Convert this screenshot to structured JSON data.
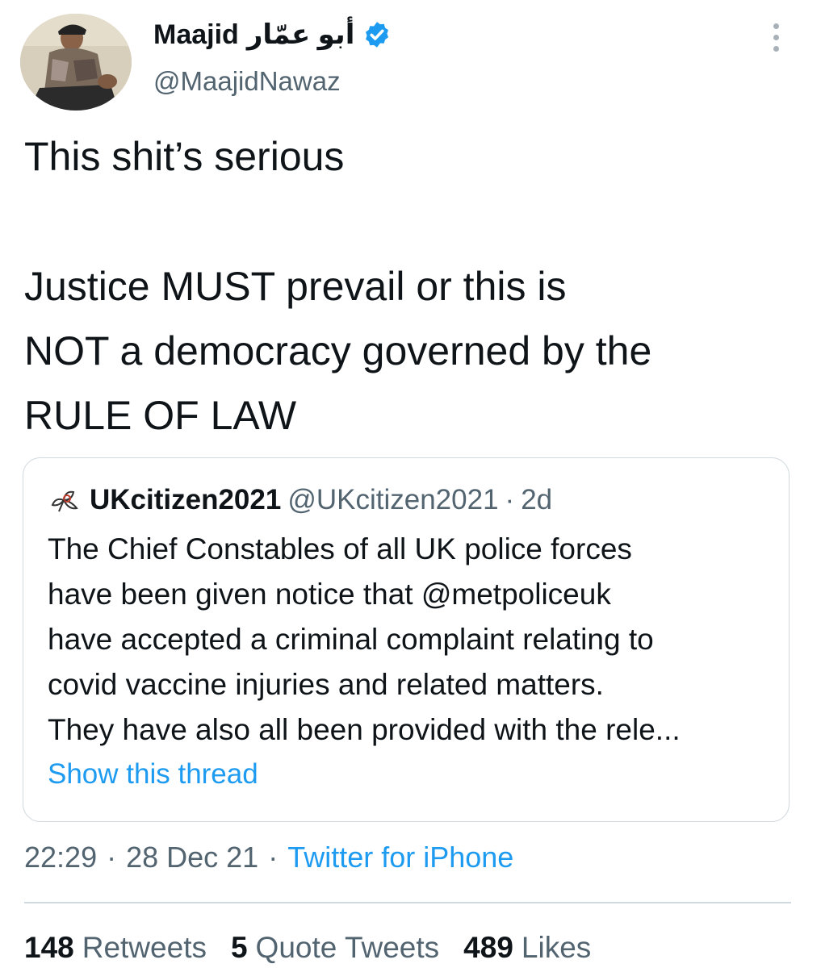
{
  "author": {
    "name": "Maajid",
    "arabic_name": "أبو عمّار",
    "handle": "@MaajidNawaz",
    "verified_icon": "verified-badge-icon"
  },
  "tweet": {
    "lines": [
      "This shit’s serious",
      "Justice MUST prevail or this is",
      "NOT a democracy governed by the",
      "RULE OF LAW"
    ]
  },
  "quoted_tweet": {
    "name": "UKcitizen2021",
    "handle": "@UKcitizen2021",
    "separator": "·",
    "time": "2d",
    "body_lines": [
      "The Chief Constables of all UK police forces",
      "have been given notice that @metpoliceuk",
      "have accepted a criminal complaint relating to",
      "covid vaccine injuries and related matters.",
      "They have also all been provided with the rele..."
    ],
    "show_thread": "Show this thread"
  },
  "meta": {
    "time": "22:29",
    "sep1": "·",
    "date": "28 Dec 21",
    "sep2": "·",
    "source": "Twitter for iPhone"
  },
  "stats": {
    "retweets_count": "148",
    "retweets_label": "Retweets",
    "quotes_count": "5",
    "quotes_label": "Quote Tweets",
    "likes_count": "489",
    "likes_label": "Likes"
  },
  "colors": {
    "link": "#1d9bf0",
    "secondary_text": "#536471",
    "border": "#cfd9de"
  }
}
